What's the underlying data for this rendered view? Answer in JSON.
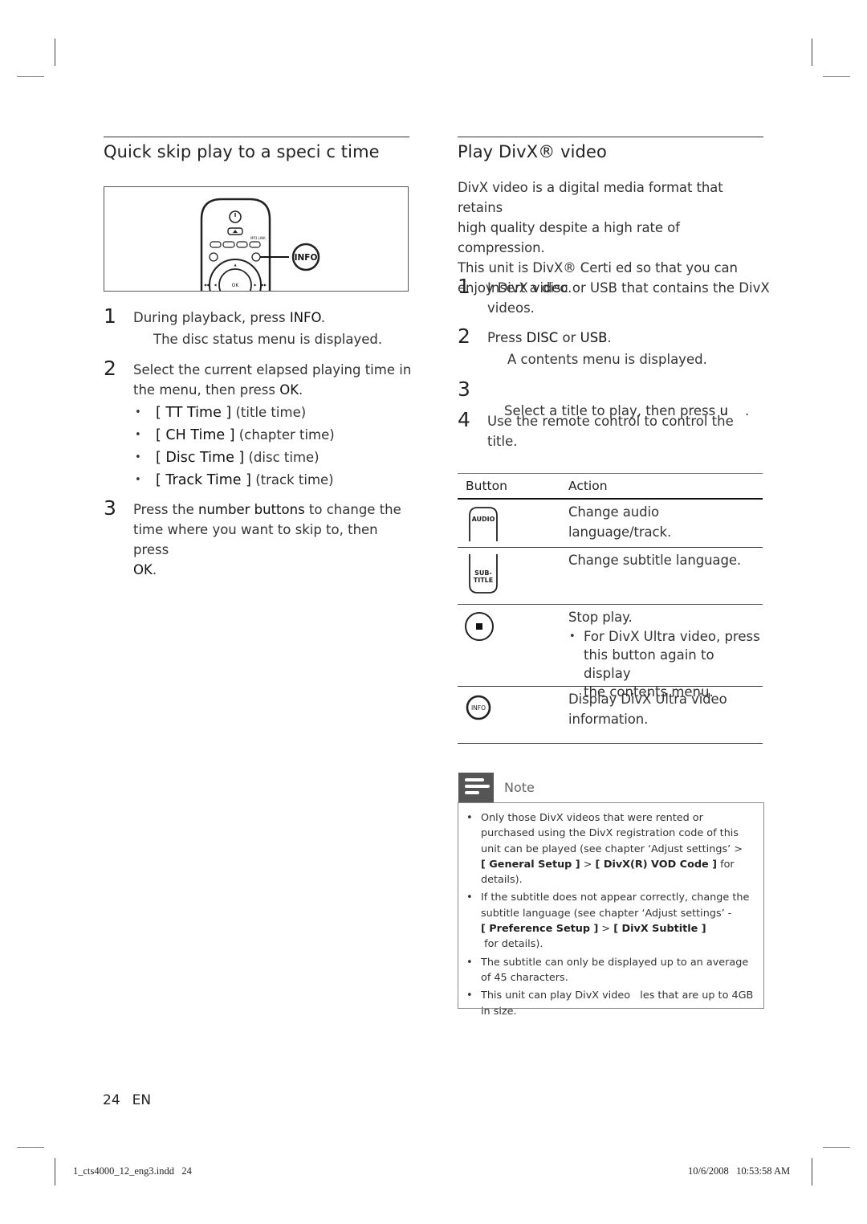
{
  "left_section": {
    "title": "Quick skip play to a speci  c time",
    "remote_labels": {
      "info_callout": "INFO",
      "ok": "OK"
    },
    "steps": [
      {
        "num": "1",
        "text_pre": "During playback, press ",
        "text_bold": "INFO",
        "text_post": ".",
        "result": "The disc status menu is displayed."
      },
      {
        "num": "2",
        "line1": "Select the current elapsed playing time in",
        "line2_pre": "the menu, then press ",
        "line2_bold": "OK",
        "line2_post": ".",
        "options": [
          {
            "label": "[ TT Time ]",
            "desc": " (title time)"
          },
          {
            "label": "[ CH Time ]",
            "desc": " (chapter time)"
          },
          {
            "label": "[ Disc Time ]",
            "desc": " (disc time)"
          },
          {
            "label": "[ Track Time ]",
            "desc": " (track time)"
          }
        ]
      },
      {
        "num": "3",
        "line1_pre": "Press the ",
        "line1_bold": "number buttons",
        "line1_post": " to change the",
        "line2": "time where you want to skip to, then press",
        "line3_bold": "OK",
        "line3_post": "."
      }
    ]
  },
  "right_section": {
    "title": "Play DivX® video",
    "intro": [
      "DivX video is a digital media format that retains",
      "high quality despite a high rate of compression.",
      "This unit is DivX® Certi  ed so that you can",
      "enjoy DivX video."
    ],
    "steps": [
      {
        "num": "1",
        "line1": "Insert a disc or USB that contains the DivX",
        "line2": "videos."
      },
      {
        "num": "2",
        "pre": "Press ",
        "bold1": "DISC",
        "mid": " or ",
        "bold2": "USB",
        "post": ".",
        "result": "A contents menu is displayed."
      },
      {
        "num": "3",
        "pre": "Select a title to play, then press ",
        "bold": "u",
        "post": "    ."
      },
      {
        "num": "4",
        "line1": "Use the remote control to control the",
        "line2": "title."
      }
    ],
    "table": {
      "headers": {
        "button": "Button",
        "action": "Action"
      },
      "rows": [
        {
          "icon": "audio-button-icon",
          "icon_label": "AUDIO",
          "action": "Change audio language/track."
        },
        {
          "icon": "subtitle-button-icon",
          "icon_label_1": "SUB-",
          "icon_label_2": "TITLE",
          "action": "Change subtitle language."
        },
        {
          "icon": "stop-button-icon",
          "action": "Stop play.",
          "bullet": [
            "For DivX Ultra video, press",
            "this button again to display",
            "the contents menu."
          ]
        },
        {
          "icon": "info-button-icon",
          "icon_label": "INFO",
          "action_1": "Display DivX Ultra video",
          "action_2": "information."
        }
      ]
    },
    "note": {
      "title": "Note",
      "items": [
        {
          "lines": [
            "Only those DivX videos that were rented or",
            "purchased using the DivX registration code of this",
            "unit can be played (see chapter ‘Adjust settings’ >"
          ],
          "b1": "[ General Setup ]",
          "sep": " > ",
          "b2": "[ DivX(R) VOD Code ]",
          "tail": " for",
          "last": "details)."
        },
        {
          "lines": [
            "If the subtitle does not appear correctly, change the",
            "subtitle language (see chapter ‘Adjust settings’ -"
          ],
          "b1": "[ Preference Setup ]",
          "sep": " > ",
          "b2": "[ DivX Subtitle ]",
          "tail": " for details)."
        },
        {
          "lines": [
            "The subtitle can only be displayed up to an average",
            "of 45 characters."
          ]
        },
        {
          "lines": [
            "This unit can play DivX video   les that are up to 4GB",
            "in size."
          ]
        }
      ]
    }
  },
  "footer": {
    "page_number": "24",
    "language": "EN",
    "file_name": "1_cts4000_12_eng3.indd   24",
    "timestamp": "10/6/2008   10:53:58 AM"
  }
}
